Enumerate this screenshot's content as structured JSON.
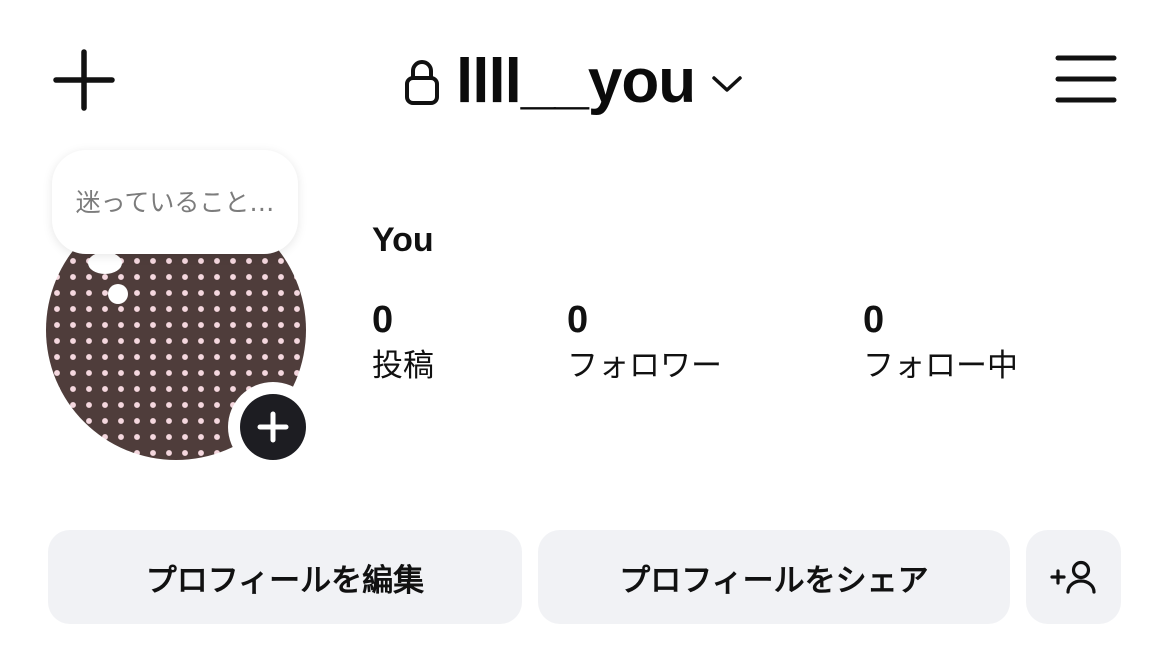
{
  "header": {
    "username": "llll__you",
    "icons": {
      "create": "plus-icon",
      "private": "lock-icon",
      "switch_account": "chevron-down-icon",
      "menu": "hamburger-menu-icon"
    }
  },
  "profile": {
    "note_placeholder": "迷っていること…",
    "display_name": "You",
    "add_story_icon": "plus-icon"
  },
  "stats": {
    "posts": {
      "count": "0",
      "label": "投稿"
    },
    "followers": {
      "count": "0",
      "label": "フォロワー"
    },
    "following": {
      "count": "0",
      "label": "フォロー中"
    }
  },
  "actions": {
    "edit_profile": "プロフィールを編集",
    "share_profile": "プロフィールをシェア",
    "discover_people_icon": "add-person-icon"
  },
  "colors": {
    "text": "#111111",
    "button_bg": "#f1f2f5",
    "note_text": "#7c7c7c",
    "avatar_bg": "#4f3d3b",
    "avatar_dots": "#f4d7de",
    "add_story_bg": "#1d1d22"
  }
}
